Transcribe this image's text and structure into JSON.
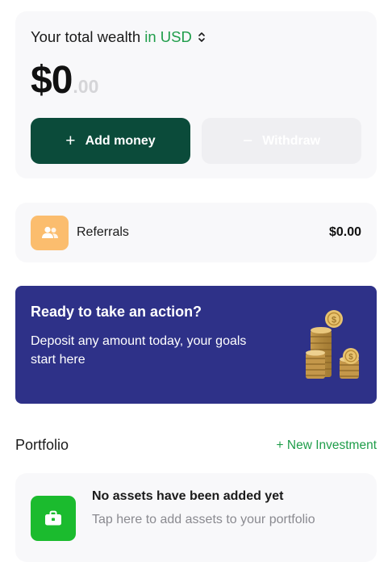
{
  "wealth": {
    "title": "Your total wealth",
    "currency_label": "in USD",
    "balance_main": "$0",
    "balance_cents": ".00"
  },
  "actions": {
    "add_label": "Add money",
    "add_glyph": "+",
    "withdraw_label": "Withdraw",
    "withdraw_glyph": "−"
  },
  "referrals": {
    "label": "Referrals",
    "amount": "$0.00",
    "icon": "users-icon"
  },
  "promo": {
    "title": "Ready to take an action?",
    "text": "Deposit any amount today, your goals start here"
  },
  "portfolio": {
    "title": "Portfolio",
    "new_investment": "+ New Investment",
    "empty_title": "No assets have been added yet",
    "empty_subtitle": "Tap here to add assets to your portfolio",
    "icon": "briefcase-icon"
  },
  "colors": {
    "accent_green": "#1f9d4a",
    "primary_button": "#0b4b3a",
    "promo_bg": "#2e3188",
    "referral_icon_bg": "#fbbd6e",
    "asset_icon_bg": "#1bbb2e"
  }
}
